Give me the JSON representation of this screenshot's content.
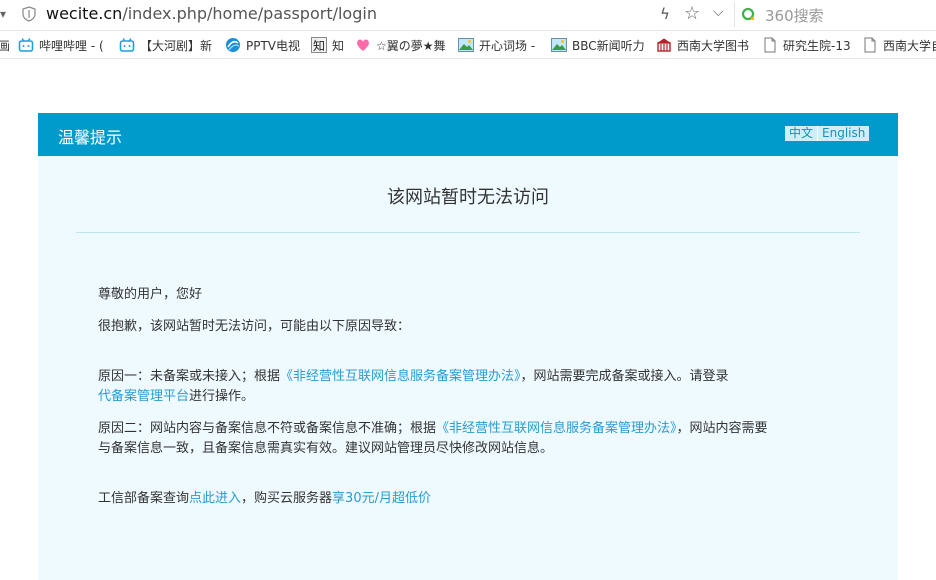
{
  "address_bar": {
    "url_host": "wecite.cn",
    "url_path": "/index.php/home/passport/login",
    "search_placeholder": "360搜索"
  },
  "bookmarks": [
    {
      "label": "哔哩哔哩 - (",
      "icon": "bilibili-icon"
    },
    {
      "label": "【大河剧】新",
      "icon": "bilibili-icon"
    },
    {
      "label": "PPTV电视",
      "icon": "pptv-icon"
    },
    {
      "label": "知",
      "icon": "zhihu-icon"
    },
    {
      "label": "☆翼の夢★舞",
      "icon": "heart-icon"
    },
    {
      "label": "开心词场 -",
      "icon": "landscape-icon"
    },
    {
      "label": "BBC新闻听力",
      "icon": "landscape-icon"
    },
    {
      "label": "西南大学图书",
      "icon": "building-icon"
    },
    {
      "label": "研究生院-13",
      "icon": "page-icon"
    },
    {
      "label": "西南大学自",
      "icon": "page-icon"
    }
  ],
  "card": {
    "header_title": "温馨提示",
    "lang_zh": "中文",
    "lang_en": "English",
    "heading": "该网站暂时无法访问",
    "greeting": "尊敬的用户，您好",
    "intro": "很抱歉，该网站暂时无法访问，可能由以下原因导致：",
    "reason1_a": "原因一：未备案或未接入；根据",
    "reason1_link": "《非经营性互联网信息服务备案管理办法》",
    "reason1_b": "，网站需要完成备案或接入。请登录",
    "reason1_link2": "代备案管理平台",
    "reason1_c": "进行操作。",
    "reason2_a": "原因二：网站内容与备案信息不符或备案信息不准确；根据",
    "reason2_link": "《非经营性互联网信息服务备案管理办法》",
    "reason2_b": "，网站内容需要",
    "reason2_c": "与备案信息一致，且备案信息需真实有效。建议网站管理员尽快修改网站信息。",
    "query_a": "工信部备案查询",
    "query_link": "点此进入",
    "query_b": "，购买云服务器",
    "query_link2": "享30元/月超低价"
  },
  "colors": {
    "header_bg": "#009bcb",
    "card_bg": "#eefaff",
    "link": "#2a9bd0"
  }
}
